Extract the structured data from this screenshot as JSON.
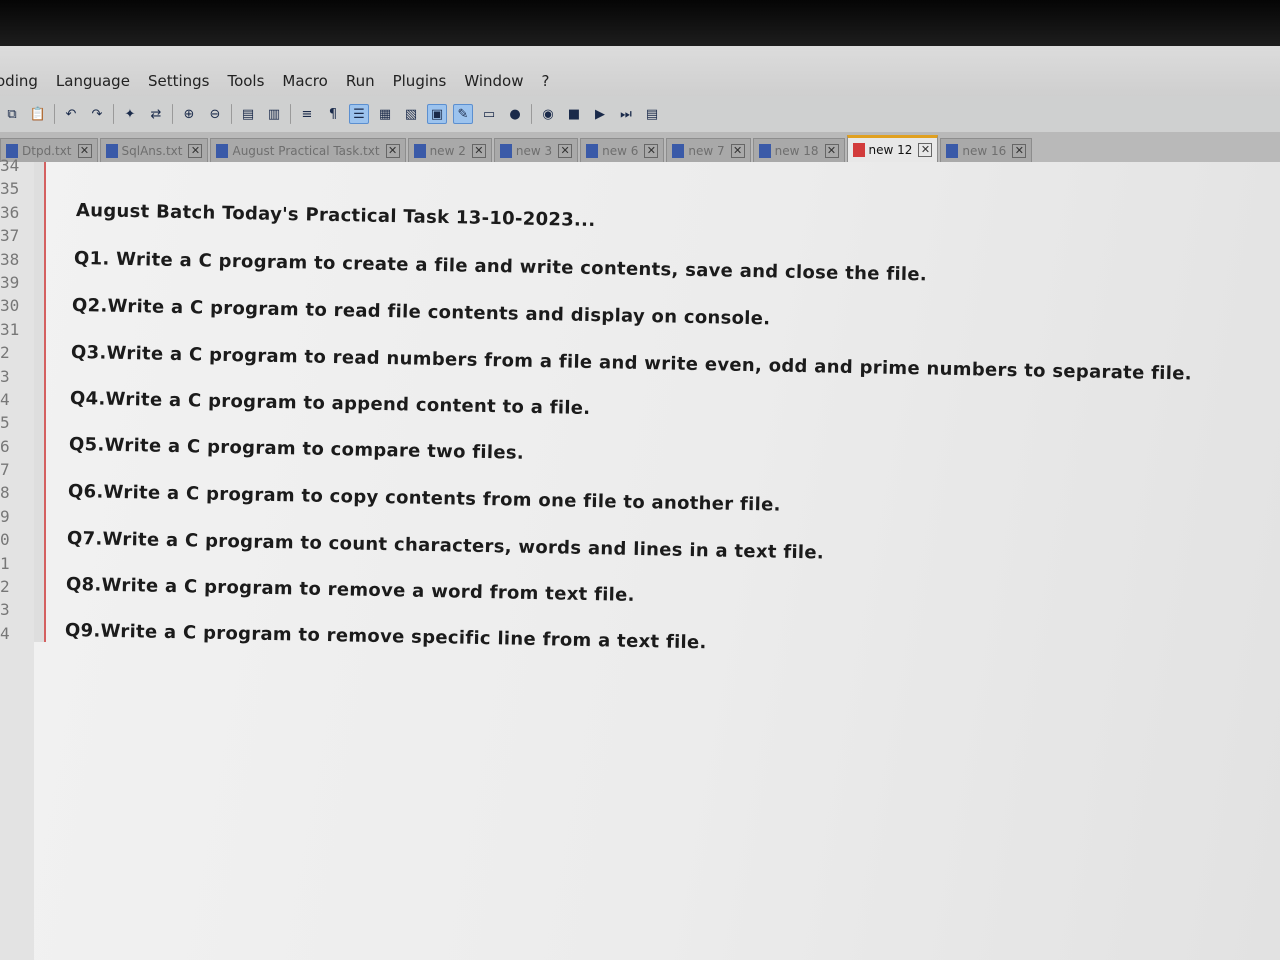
{
  "menu": [
    "oding",
    "Language",
    "Settings",
    "Tools",
    "Macro",
    "Run",
    "Plugins",
    "Window",
    "?"
  ],
  "tabs": [
    {
      "label": "Dtpd.txt",
      "active": false
    },
    {
      "label": "SqlAns.txt",
      "active": false
    },
    {
      "label": "August Practical Task.txt",
      "active": false
    },
    {
      "label": "new 2",
      "active": false
    },
    {
      "label": "new 3",
      "active": false
    },
    {
      "label": "new 6",
      "active": false
    },
    {
      "label": "new 7",
      "active": false
    },
    {
      "label": "new 18",
      "active": false
    },
    {
      "label": "new 12",
      "active": true
    },
    {
      "label": "new 16",
      "active": false
    }
  ],
  "line_numbers": [
    "34",
    "35",
    "36",
    "37",
    "38",
    "39",
    "30",
    "31",
    "2",
    "3",
    "4",
    "5",
    "6",
    "7",
    "8",
    "9",
    "0",
    "1",
    "2",
    "3",
    "4"
  ],
  "document": {
    "lines": [
      "August Batch Today's Practical Task 13-10-2023...",
      "Q1. Write a C program to create a file and write contents, save and close the file.",
      "Q2.Write a C program to read file contents and display on console.",
      "Q3.Write a C program to read numbers from a file and write even, odd and prime numbers to separate file.",
      "Q4.Write a C program to append content to a file.",
      "Q5.Write a C program to compare two files.",
      "Q6.Write a C program to copy contents from one file to another file.",
      "Q7.Write a C program to count characters, words and lines in a text file.",
      "Q8.Write a C program to remove a word from text file.",
      "Q9.Write a C program to remove specific line from a text file."
    ]
  },
  "colors": {
    "active_tab_accent": "#e0a020",
    "fold_margin": "#d46060",
    "text": "#1b1b1b"
  }
}
